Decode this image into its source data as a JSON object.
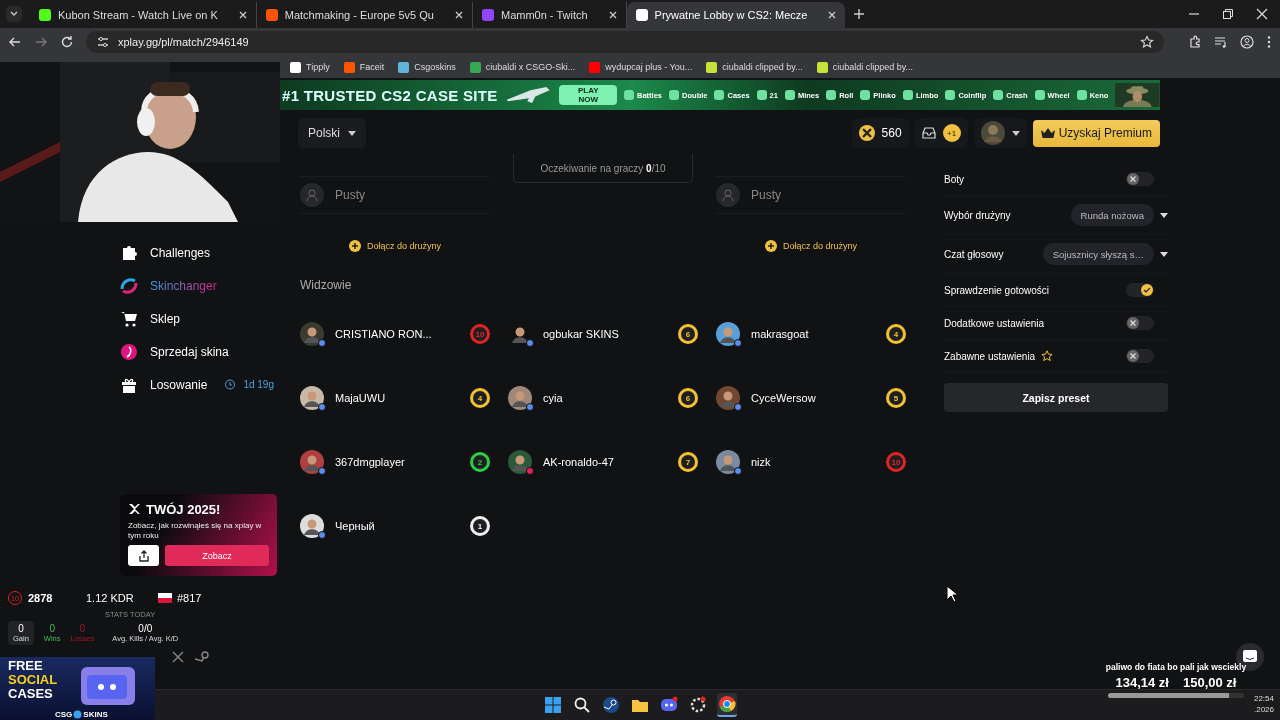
{
  "browser": {
    "tabs": [
      {
        "title": "Kubon Stream - Watch Live on K",
        "selected": false,
        "color": "#53fc18"
      },
      {
        "title": "Matchmaking - Europe 5v5 Qu",
        "selected": false,
        "color": "#ff5500"
      },
      {
        "title": "Mamm0n - Twitch",
        "selected": false,
        "color": "#9146ff"
      },
      {
        "title": "Prywatne Lobby w CS2: Mecze",
        "selected": true,
        "color": "#ffffff"
      }
    ],
    "url": "xplay.gg/pl/match/2946149",
    "bookmarks": [
      {
        "label": "Tipply",
        "color": "#ffffff"
      },
      {
        "label": "Faceit",
        "color": "#ff5500"
      },
      {
        "label": "Csgoskins",
        "color": "#5fb4d8"
      },
      {
        "label": "ciubaldi x CSGO-Ski...",
        "color": "#34a853"
      },
      {
        "label": "wydupcaj plus - You...",
        "color": "#ff0000"
      },
      {
        "label": "ciubaldi clipped by...",
        "color": "#c6e23a"
      },
      {
        "label": "ciubaldi clipped by...",
        "color": "#c6e23a"
      }
    ]
  },
  "banner": {
    "headline": "#1 TRUSTED CS2 CASE SITE",
    "cta": "PLAY NOW",
    "games": [
      "Battles",
      "Double",
      "Cases",
      "21",
      "Mines",
      "Roll",
      "Plinko",
      "Limbo",
      "Coinflip",
      "Crash",
      "Wheel",
      "Keno"
    ]
  },
  "header": {
    "language": "Polski",
    "coins": "560",
    "notifications": "+1",
    "premium": "Uzyskaj Premium"
  },
  "sidebar": {
    "items": [
      {
        "label": "Challenges",
        "highlighted": false
      },
      {
        "label": "Skinchanger",
        "highlighted": true
      },
      {
        "label": "Sklep",
        "highlighted": false
      },
      {
        "label": "Sprzedaj skina",
        "highlighted": false
      },
      {
        "label": "Losowanie",
        "highlighted": false,
        "timer": "1d 19g"
      }
    ]
  },
  "promo": {
    "title": "TWÓJ 2025!",
    "text": "Zobacz, jak rozwinąłeś się na xplay w tym roku",
    "button": "Zobacz"
  },
  "stats": {
    "level": "10",
    "elo": "2878",
    "kdr": "1.12 KDR",
    "rank": "#817",
    "today_label": "STATS TODAY",
    "today": [
      {
        "value": "0",
        "label": "Gain",
        "kind": "gain"
      },
      {
        "value": "0",
        "label": "Wins",
        "kind": "wins"
      },
      {
        "value": "0",
        "label": "Losses",
        "kind": "losses"
      },
      {
        "value": "0/0",
        "label": "Avg. Kills / Avg. K/D",
        "kind": "average"
      }
    ]
  },
  "lobby": {
    "waiting": "Oczekiwanie na graczy **0**/10",
    "teams": [
      {
        "slot": "Pusty",
        "join": "Dołącz do drużyny"
      },
      {
        "slot": "Pusty",
        "join": "Dołącz do drużyny"
      }
    ],
    "spectators_title": "Widzowie",
    "spectators": [
      {
        "name": "CRISTIANO RON...",
        "badge": {
          "text": "10",
          "color": "#e02424"
        },
        "status": {
          "color": "#5b8def"
        }
      },
      {
        "name": "ogbukar SKINS",
        "badge": {
          "text": "6",
          "color": "#f2c230"
        },
        "status": {
          "color": "#5b8def"
        }
      },
      {
        "name": "makrasgoat",
        "badge": {
          "text": "4",
          "color": "#f2c230"
        },
        "status": {
          "color": "#5b8def"
        }
      },
      {
        "name": "MajaUWU",
        "badge": {
          "text": "4",
          "color": "#f2c230"
        },
        "status": {
          "color": "#5b8def"
        }
      },
      {
        "name": "cyia",
        "badge": {
          "text": "6",
          "color": "#f2c230"
        },
        "status": {
          "color": "#5b8def"
        }
      },
      {
        "name": "CyceWersow",
        "badge": {
          "text": "5",
          "color": "#f2c230"
        },
        "status": {
          "color": "#5b8def"
        }
      },
      {
        "name": "367dmgplayer",
        "badge": {
          "text": "2",
          "color": "#2ecc40"
        },
        "status": {
          "color": "#5b8def"
        }
      },
      {
        "name": "AK-ronaldo-47",
        "badge": {
          "text": "7",
          "color": "#f2c230"
        },
        "status": {
          "color": "#e0245e"
        }
      },
      {
        "name": "nizk",
        "badge": {
          "text": "10",
          "color": "#e02424"
        },
        "status": {
          "color": "#5b8def"
        }
      },
      {
        "name": "Черный",
        "badge": {
          "text": "1",
          "color": "#eeeeee"
        },
        "status": {
          "color": "#5b8def"
        }
      }
    ]
  },
  "settings": {
    "rows": [
      {
        "kind": "toggle",
        "label": "Boty",
        "on": false,
        "star": false
      },
      {
        "kind": "select",
        "label": "Wybór drużyny",
        "value": "Runda nożowa",
        "star": false
      },
      {
        "kind": "select",
        "label": "Czat głosowy",
        "value": "Sojusznicy słyszą s…",
        "star": false
      },
      {
        "kind": "toggle",
        "label": "Sprawdzenie gotowości",
        "on": true,
        "star": false
      },
      {
        "kind": "toggle",
        "label": "Dodatkowe ustawienia",
        "on": false,
        "star": false
      },
      {
        "kind": "toggle",
        "label": "Zabawne ustawienia",
        "on": false,
        "star": true
      }
    ],
    "save": "Zapisz preset"
  },
  "overlays": {
    "ad": {
      "lines": [
        "FREE",
        "SOCIAL",
        "CASES"
      ],
      "brand_left": "CSG",
      "brand_right": "SKINS"
    },
    "donation": {
      "message": "paliwo do fiata bo pali jak wsciekly",
      "raised": "134,14 zł",
      "goal": "150,00 zł",
      "level": 0.89
    }
  },
  "taskbar": {
    "apps": [
      {
        "selected": false
      },
      {
        "selected": false
      },
      {
        "selected": false
      },
      {
        "selected": false
      },
      {
        "selected": false
      },
      {
        "selected": false
      },
      {
        "selected": true
      }
    ],
    "time": "22:54",
    "date": ".2026"
  }
}
